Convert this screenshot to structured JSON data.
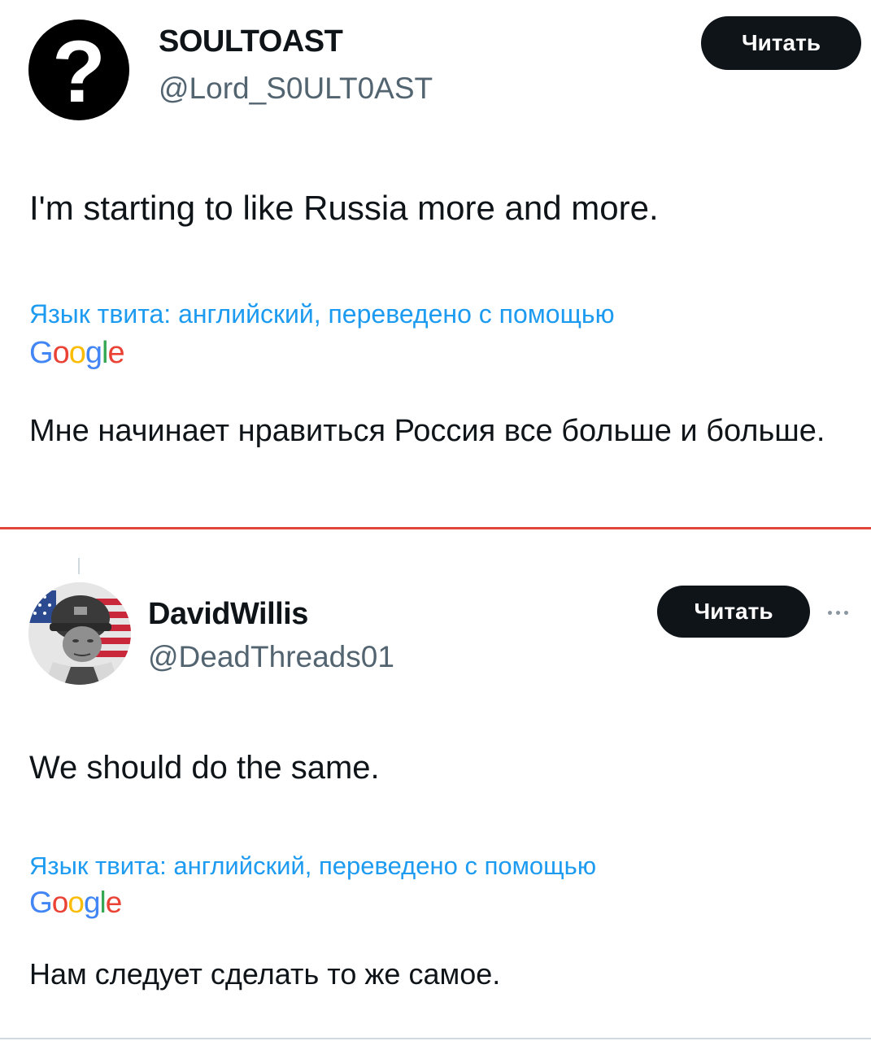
{
  "tweets": [
    {
      "display_name": "SOULTOAST",
      "handle": "@Lord_S0ULT0AST",
      "avatar": "question-mark",
      "follow_label": "Читать",
      "text": "I'm starting to like Russia more and more.",
      "translated_note": "Язык твита: английский, переведено с помощью",
      "translation": "Мне начинает нравиться Россия все больше и больше."
    },
    {
      "display_name": "DavidWillis",
      "handle": "@DeadThreads01",
      "avatar": "soldier-portrait-with-flag",
      "follow_label": "Читать",
      "more_icon": "more-dots-icon",
      "text": "We should do the same.",
      "translated_note": "Язык твита: английский, переведено с помощью",
      "translation": "Нам следует сделать то же самое."
    }
  ],
  "google_logo": {
    "letters": [
      "G",
      "o",
      "o",
      "g",
      "l",
      "e"
    ],
    "colors": [
      "#4285f4",
      "#ea4335",
      "#fbbc05",
      "#4285f4",
      "#34a853",
      "#ea4335"
    ]
  },
  "colors": {
    "follow_button": "#0f1419",
    "handle": "#536471",
    "translated_note": "#1d9bf0",
    "divider": "#e0473a"
  }
}
